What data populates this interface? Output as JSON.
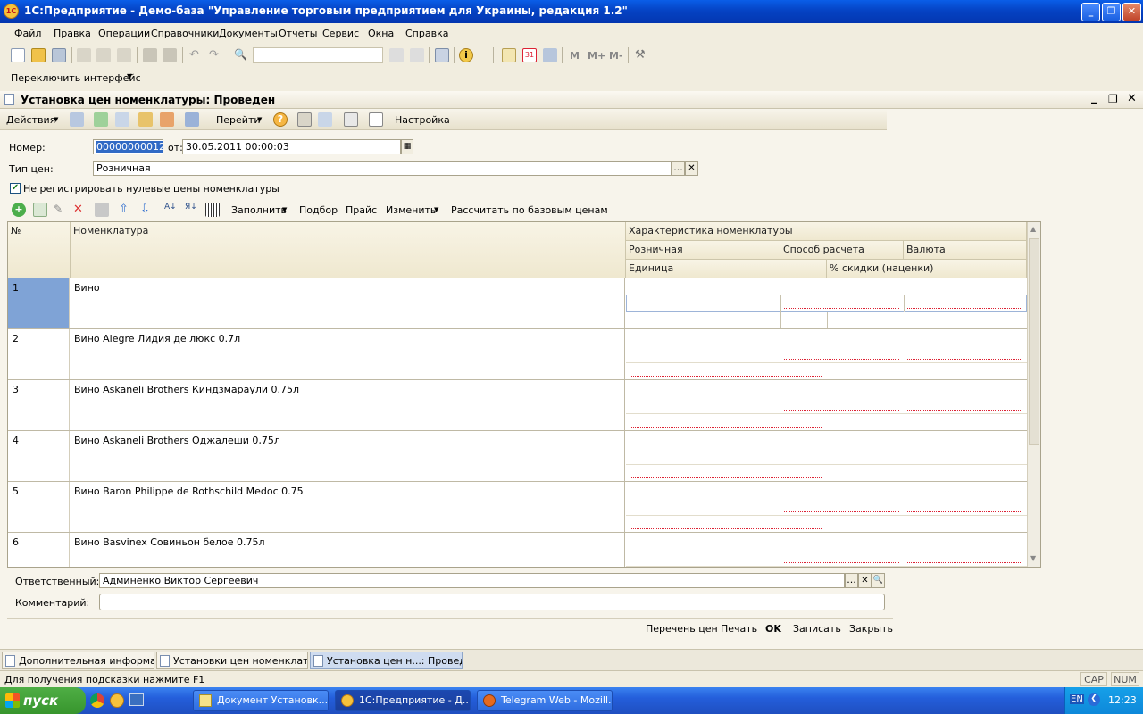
{
  "window": {
    "title": "1С:Предприятие - Демо-база \"Управление торговым предприятием для Украины, редакция 1.2\"",
    "icon_text": "1C"
  },
  "menu": [
    "Файл",
    "Правка",
    "Операции",
    "Справочники",
    "Документы",
    "Отчеты",
    "Сервис",
    "Окна",
    "Справка"
  ],
  "toolbar2": {
    "switch_interface": "Переключить интерфейс"
  },
  "toolbar1": {
    "m": "M",
    "mplus": "M+",
    "mminus": "M-"
  },
  "document": {
    "title": "Установка цен номенклатуры: Проведен"
  },
  "doc_toolbar": {
    "actions": "Действия",
    "goto": "Перейти",
    "settings": "Настройка"
  },
  "form": {
    "number_label": "Номер:",
    "number_value": "00000000012",
    "date_label": "от:",
    "date_value": "30.05.2011 00:00:03",
    "price_type_label": "Тип цен:",
    "price_type_value": "Розничная",
    "checkbox_label": "Не регистрировать нулевые цены номенклатуры",
    "responsible_label": "Ответственный:",
    "responsible_value": "Админенко Виктор Сергеевич",
    "comment_label": "Комментарий:",
    "comment_value": ""
  },
  "table_toolbar": {
    "fill": "Заполнить",
    "pick": "Подбор",
    "price": "Прайс",
    "change": "Изменить",
    "calc": "Рассчитать по базовым ценам"
  },
  "table": {
    "headers": {
      "num": "№",
      "name": "Номенклатура",
      "char": "Характеристика номенклатуры",
      "retail": "Розничная",
      "method": "Способ расчета",
      "currency": "Валюта",
      "unit": "Единица",
      "discount": "% скидки (наценки)"
    },
    "rows": [
      {
        "num": "1",
        "name": "Вино"
      },
      {
        "num": "2",
        "name": "Вино Alegre Лидия де люкс 0.7л"
      },
      {
        "num": "3",
        "name": "Вино Askaneli Brothers Киндзмараули 0.75л"
      },
      {
        "num": "4",
        "name": "Вино Askaneli Brothers Оджалеши 0,75л"
      },
      {
        "num": "5",
        "name": "Вино Baron Philippe de Rothschild Medoc 0.75"
      },
      {
        "num": "6",
        "name": "Вино Basvinex Совиньон белое 0.75л"
      }
    ]
  },
  "bottom_buttons": {
    "price_list": "Перечень цен",
    "print": "Печать",
    "ok": "OK",
    "save": "Записать",
    "close": "Закрыть"
  },
  "tabs": [
    "Дополнительная информац...",
    "Установки цен номенклату...",
    "Установка цен н...: Проведен"
  ],
  "status": {
    "hint": "Для получения подсказки нажмите F1",
    "cap": "CAP",
    "num": "NUM"
  },
  "taskbar": {
    "start": "пуск",
    "tasks": [
      "Документ Установк...",
      "1С:Предприятие - Д...",
      "Telegram Web - Mozill..."
    ],
    "lang": "EN",
    "time": "12:23"
  }
}
